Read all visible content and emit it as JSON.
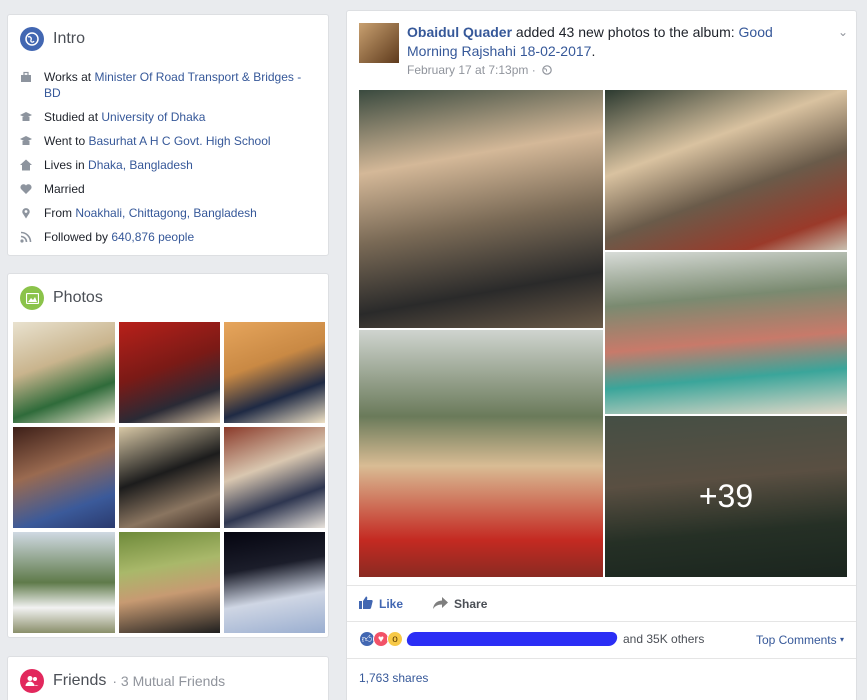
{
  "intro": {
    "title": "Intro",
    "rows": [
      {
        "icon": "briefcase-icon",
        "prefix": "Works at ",
        "link": "Minister Of Road Transport & Bridges - BD"
      },
      {
        "icon": "graduation-cap-icon",
        "prefix": "Studied at ",
        "link": "University of Dhaka"
      },
      {
        "icon": "graduation-cap-icon",
        "prefix": "Went to ",
        "link": "Basurhat A H C Govt. High School"
      },
      {
        "icon": "home-icon",
        "prefix": "Lives in ",
        "link": "Dhaka, Bangladesh"
      },
      {
        "icon": "heart-icon",
        "prefix": "Married",
        "link": ""
      },
      {
        "icon": "location-pin-icon",
        "prefix": "From ",
        "link": "Noakhali, Chittagong, Bangladesh"
      },
      {
        "icon": "rss-icon",
        "prefix": "Followed by ",
        "link": "640,876 people"
      }
    ]
  },
  "photos": {
    "title": "Photos",
    "thumbs": [
      "#8a6b3c",
      "#7a2e22",
      "#b07a48",
      "#3b4a6b",
      "#6e5a3a",
      "#5a2a2a",
      "#7a8a6a",
      "#6a7a3a",
      "#1e2440"
    ]
  },
  "friends": {
    "title": "Friends",
    "mutual": "· 3 Mutual Friends"
  },
  "post": {
    "author": "Obaidul Quader",
    "action": " added 43 new photos to the album: ",
    "album": "Good Morning Rajshahi 18-02-2017",
    "after_album": ".",
    "time": "February 17 at 7:13pm ·",
    "more_count": "+39",
    "like_label": "Like",
    "share_label": "Share",
    "reactions_text": "and 35K others",
    "top_comments": "Top Comments",
    "shares": "1,763 shares"
  },
  "colors": {
    "brand_blue": "#365899",
    "intro_icon": "#4267b2",
    "photos_icon": "#8bc34a",
    "friends_icon": "#e2285d"
  }
}
